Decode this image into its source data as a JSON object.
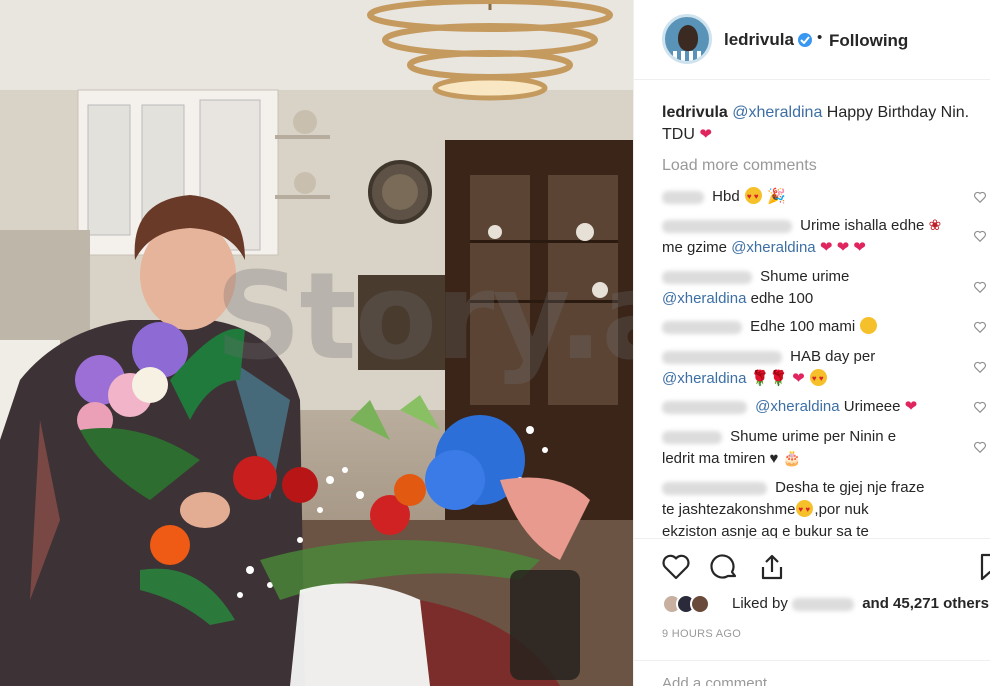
{
  "post": {
    "username": "ledrivula",
    "follow_status": "Following",
    "caption": {
      "username": "ledrivula",
      "mention": "@xheraldina",
      "text_part1": "Happy Birthday Nin.",
      "text_part2": "TDU"
    },
    "load_more": "Load more comments",
    "watermark": "Story.al",
    "comments": [
      {
        "text": "Hbd"
      },
      {
        "text1": "Urime ishalla edhe",
        "text2": "me gzime",
        "mention": "@xheraldina"
      },
      {
        "text1": "Shume urime",
        "mention": "@xheraldina",
        "text2": "edhe 100"
      },
      {
        "text": "Edhe 100 mami"
      },
      {
        "text1": "HAB day per",
        "mention": "@xheraldina"
      },
      {
        "mention": "@xheraldina",
        "text": "Urimeee"
      },
      {
        "text1": "Shume urime per Ninin e",
        "text2": "ledrit ma tmiren"
      },
      {
        "text1": "Desha te gjej nje fraze",
        "text2": "te jashtezakonshme",
        "text3": ",por nuk",
        "text4": "ekziston asnje aq e bukur sa te"
      }
    ],
    "liked_by": {
      "prefix": "Liked by",
      "suffix": "and 45,271 others"
    },
    "time_ago": "9 HOURS AGO",
    "add_comment_placeholder": "Add a comment..."
  },
  "colors": {
    "link": "#3d6fa5",
    "verified": "#3897f0",
    "muted": "#999999",
    "heart_red": "#e0245e"
  },
  "icons": [
    "verified-badge-icon",
    "like-icon",
    "comment-icon",
    "share-icon",
    "bookmark-icon",
    "comment-like-icon"
  ]
}
